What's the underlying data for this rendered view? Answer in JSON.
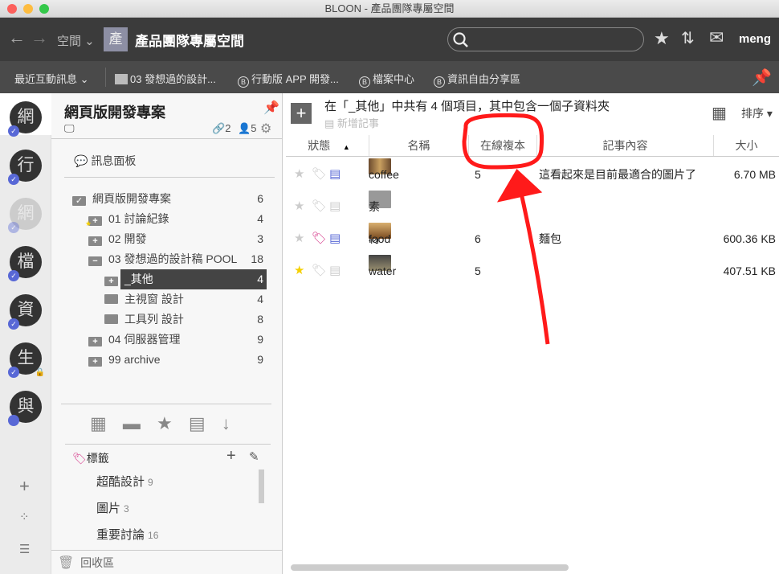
{
  "window": {
    "title": "BLOON - 產品團隊專屬空間"
  },
  "toolbar": {
    "space_menu": "空間",
    "space_avatar": "產",
    "space_title": "產品團隊專屬空間",
    "search_placeholder": "",
    "user": "meng"
  },
  "bookmarks": {
    "recent": "最近互動訊息",
    "items": [
      {
        "label": "03 發想過的設計...",
        "icon": "folder-icon"
      },
      {
        "label": "行動版 APP 開發...",
        "icon": "b-circle-icon"
      },
      {
        "label": "檔案中心",
        "icon": "b-circle-icon"
      },
      {
        "label": "資訊自由分享區",
        "icon": "b-circle-icon"
      }
    ]
  },
  "rail": {
    "spaces": [
      {
        "char": "網",
        "checked": true,
        "dim": false
      },
      {
        "char": "行",
        "checked": true,
        "dim": false
      },
      {
        "char": "網",
        "checked": true,
        "dim": true
      },
      {
        "char": "檔",
        "checked": true,
        "dim": false
      },
      {
        "char": "資",
        "checked": true,
        "dim": false
      },
      {
        "char": "生",
        "checked": true,
        "dim": false,
        "locked": true
      },
      {
        "char": "與",
        "checked": false,
        "dim": false
      }
    ]
  },
  "sidebar": {
    "project_title": "網頁版開發專案",
    "link_count": "2",
    "member_count": "5",
    "message_board": "訊息面板",
    "tree": [
      {
        "label": "網頁版開發專案",
        "count": "6",
        "level": 0
      },
      {
        "label": "01 討論紀錄",
        "count": "4",
        "level": 1,
        "starred": true
      },
      {
        "label": "02 開發",
        "count": "3",
        "level": 1
      },
      {
        "label": "03 發想過的設計稿 POOL",
        "count": "18",
        "level": 1,
        "open": true
      },
      {
        "label": "_其他",
        "count": "4",
        "level": 2,
        "selected": true
      },
      {
        "label": "主視窗 設計",
        "count": "4",
        "level": 2
      },
      {
        "label": "工具列 設計",
        "count": "8",
        "level": 2
      },
      {
        "label": "04 伺服器管理",
        "count": "9",
        "level": 1
      },
      {
        "label": "99 archive",
        "count": "9",
        "level": 1
      }
    ],
    "tags_title": "標籤",
    "tags": [
      {
        "name": "超酷設計",
        "count": "9"
      },
      {
        "name": "圖片",
        "count": "3"
      },
      {
        "name": "重要討論",
        "count": "16"
      }
    ],
    "trash": "回收區"
  },
  "main": {
    "summary": "在「_其他」中共有 4 個項目，其中包含一個子資料夾",
    "new_note": "新增記事",
    "sort": "排序",
    "columns": {
      "status": "狀態",
      "name": "名稱",
      "online_copies": "在線複本",
      "note": "記事內容",
      "size": "大小"
    },
    "rows": [
      {
        "name": "coffee",
        "copies": "5",
        "note": "這看起來是目前最適合的圖片了",
        "size": "6.70 MB",
        "starred": false,
        "tagged": false,
        "has_note": true,
        "type": "image"
      },
      {
        "name": "素材",
        "copies": "",
        "note": "",
        "size": "",
        "starred": false,
        "tagged": false,
        "has_note": false,
        "type": "folder"
      },
      {
        "name": "food",
        "copies": "6",
        "note": "麵包",
        "size": "600.36 KB",
        "starred": false,
        "tagged": true,
        "has_note": true,
        "type": "image"
      },
      {
        "name": "water",
        "copies": "5",
        "note": "",
        "size": "407.51 KB",
        "starred": true,
        "tagged": false,
        "has_note": false,
        "type": "image"
      }
    ]
  },
  "colors": {
    "accent": "#5868d6",
    "tag": "#d63c8c",
    "star": "#f5d000",
    "link": "#3cae3c",
    "annotation": "#ff1a1a"
  }
}
